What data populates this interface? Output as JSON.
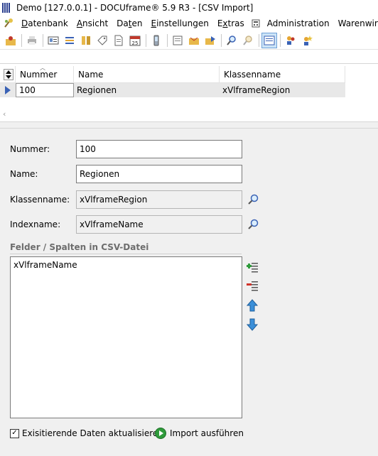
{
  "window": {
    "title": "Demo [127.0.0.1] - DOCUframe® 5.9 R3 - [CSV Import]"
  },
  "menu": {
    "items": [
      {
        "prefix": "",
        "mnemonic": "D",
        "rest": "atenbank"
      },
      {
        "prefix": "",
        "mnemonic": "A",
        "rest": "nsicht"
      },
      {
        "prefix": "Da",
        "mnemonic": "t",
        "rest": "en"
      },
      {
        "prefix": "",
        "mnemonic": "E",
        "rest": "instellungen"
      },
      {
        "prefix": "E",
        "mnemonic": "x",
        "rest": "tras"
      },
      {
        "prefix": "",
        "mnemonic": "",
        "rest": "Administration"
      },
      {
        "prefix": "",
        "mnemonic": "",
        "rest": "Warenwirtschaft"
      }
    ]
  },
  "grid": {
    "columns": [
      "Nummer",
      "Name",
      "Klassenname"
    ],
    "rows": [
      {
        "nummer": "100",
        "name": "Regionen",
        "klassenname": "xVlframeRegion"
      }
    ]
  },
  "form": {
    "nummer_label": "Nummer:",
    "nummer_value": "100",
    "name_label": "Name:",
    "name_value": "Regionen",
    "klassenname_label": "Klassenname:",
    "klassenname_value": "xVlframeRegion",
    "indexname_label": "Indexname:",
    "indexname_value": "xVlframeName",
    "fields_group_title": "Felder / Spalten in CSV-Datei",
    "fields": [
      "xVlframeName"
    ],
    "update_checkbox_label": "Exisitierende Daten aktualisieren",
    "update_checkbox_checked": true,
    "import_button_label": "Import ausführen"
  },
  "colors": {
    "accent": "#2a3f8f",
    "selection": "#cde4f7",
    "play": "#2f9b3b"
  }
}
